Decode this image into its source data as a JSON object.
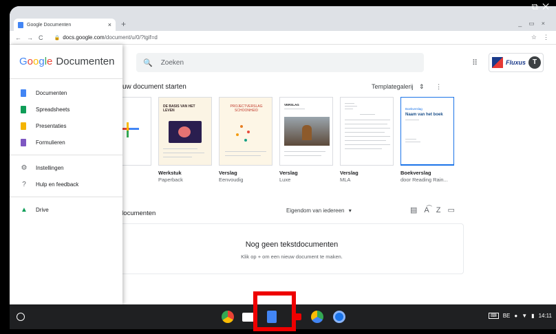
{
  "browser": {
    "tab_title": "Google Documenten",
    "url_host": "docs.google.com",
    "url_path": "/document/u/0/?tgif=d",
    "new_tab": "+"
  },
  "docs": {
    "brand_google": "Google",
    "brand_product": "Documenten",
    "search_placeholder": "Zoeken",
    "account_name": "Fluxus",
    "account_initial": "T"
  },
  "sidebar": {
    "items": [
      {
        "label": "Documenten",
        "color": "#4285f4"
      },
      {
        "label": "Spreadsheets",
        "color": "#0f9d58"
      },
      {
        "label": "Presentaties",
        "color": "#f4b400"
      },
      {
        "label": "Formulieren",
        "color": "#7e57c2"
      }
    ],
    "settings": "Instellingen",
    "help": "Hulp en feedback",
    "drive": "Drive"
  },
  "main": {
    "start_title": "uw document starten",
    "template_gallery": "Templategalerij",
    "templates": [
      {
        "title": "Werkstuk",
        "subtitle": "Paperback",
        "thumb": "DE BASIS VAN HET LEVEN"
      },
      {
        "title": "Verslag",
        "subtitle": "Eenvoudig",
        "thumb": "PROJECTVERSLAG SCHOONHEID"
      },
      {
        "title": "Verslag",
        "subtitle": "Luxe",
        "thumb": "VERSLAG"
      },
      {
        "title": "Verslag",
        "subtitle": "MLA",
        "thumb": ""
      },
      {
        "title": "Boekverslag",
        "subtitle": "door Reading Rain...",
        "thumb": "Naam van het boek",
        "thumb_sub": "Boekverslag"
      }
    ],
    "recent_title": "documenten",
    "owner_filter": "Eigendom van iedereen",
    "empty_title": "Nog geen tekstdocumenten",
    "empty_sub": "Klik op + om een nieuw document te maken."
  },
  "shelf": {
    "locale": "BE",
    "time": "14:11"
  }
}
